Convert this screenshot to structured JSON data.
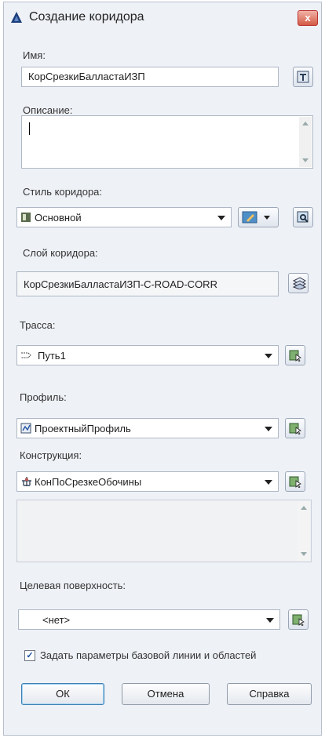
{
  "window": {
    "title": "Создание коридора",
    "close_glyph": "x"
  },
  "name": {
    "label": "Имя:",
    "value": "КорСрезкиБалластаИЗП"
  },
  "description": {
    "label": "Описание:",
    "value": ""
  },
  "corridor_style": {
    "label": "Стиль коридора:",
    "value": "Основной"
  },
  "corridor_layer": {
    "label": "Слой коридора:",
    "value": "КорСрезкиБалластаИЗП-C-ROAD-CORR"
  },
  "alignment": {
    "label": "Трасса:",
    "value": "Путь1"
  },
  "profile": {
    "label": "Профиль:",
    "value": "ПроектныйПрофиль"
  },
  "assembly": {
    "label": "Конструкция:",
    "value": "КонПоСрезкеОбочины"
  },
  "target_surface": {
    "label": "Целевая поверхность:",
    "value": "<нет>"
  },
  "baseline_checkbox": {
    "label": "Задать параметры базовой линии и областей",
    "checked": true,
    "glyph": "✓"
  },
  "buttons": {
    "ok": "ОК",
    "cancel": "Отмена",
    "help": "Справка"
  },
  "icons": {
    "title": "autocad-triangle-icon",
    "name_picker": "name-template-icon",
    "style_edit": "edit-style-icon",
    "style_view": "preview-style-icon",
    "layer": "layers-icon",
    "pick": "pick-from-drawing-icon"
  }
}
